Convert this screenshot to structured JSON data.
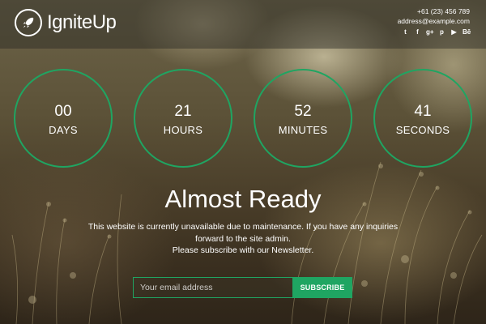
{
  "brand": {
    "name": "IgniteUp"
  },
  "contact": {
    "phone": "+61 (23) 456 789",
    "email": "address@example.com"
  },
  "socials": [
    {
      "name": "twitter-icon",
      "glyph": "t"
    },
    {
      "name": "facebook-icon",
      "glyph": "f"
    },
    {
      "name": "google-plus-icon",
      "glyph": "g+"
    },
    {
      "name": "pinterest-icon",
      "glyph": "p"
    },
    {
      "name": "youtube-icon",
      "glyph": "▶"
    },
    {
      "name": "behance-icon",
      "glyph": "Bē"
    }
  ],
  "countdown": [
    {
      "value": "00",
      "label": "DAYS"
    },
    {
      "value": "21",
      "label": "HOURS"
    },
    {
      "value": "52",
      "label": "MINUTES"
    },
    {
      "value": "41",
      "label": "SECONDS"
    }
  ],
  "headline": "Almost Ready",
  "message": {
    "line1": "This website is currently unavailable due to maintenance. If you have any inquiries forward to the site admin.",
    "line2": "Please subscribe with our Newsletter."
  },
  "newsletter": {
    "placeholder": "Your email address",
    "button": "SUBSCRIBE"
  },
  "colors": {
    "accent": "#1fa562",
    "topbar": "rgba(40,40,36,0.45)"
  }
}
